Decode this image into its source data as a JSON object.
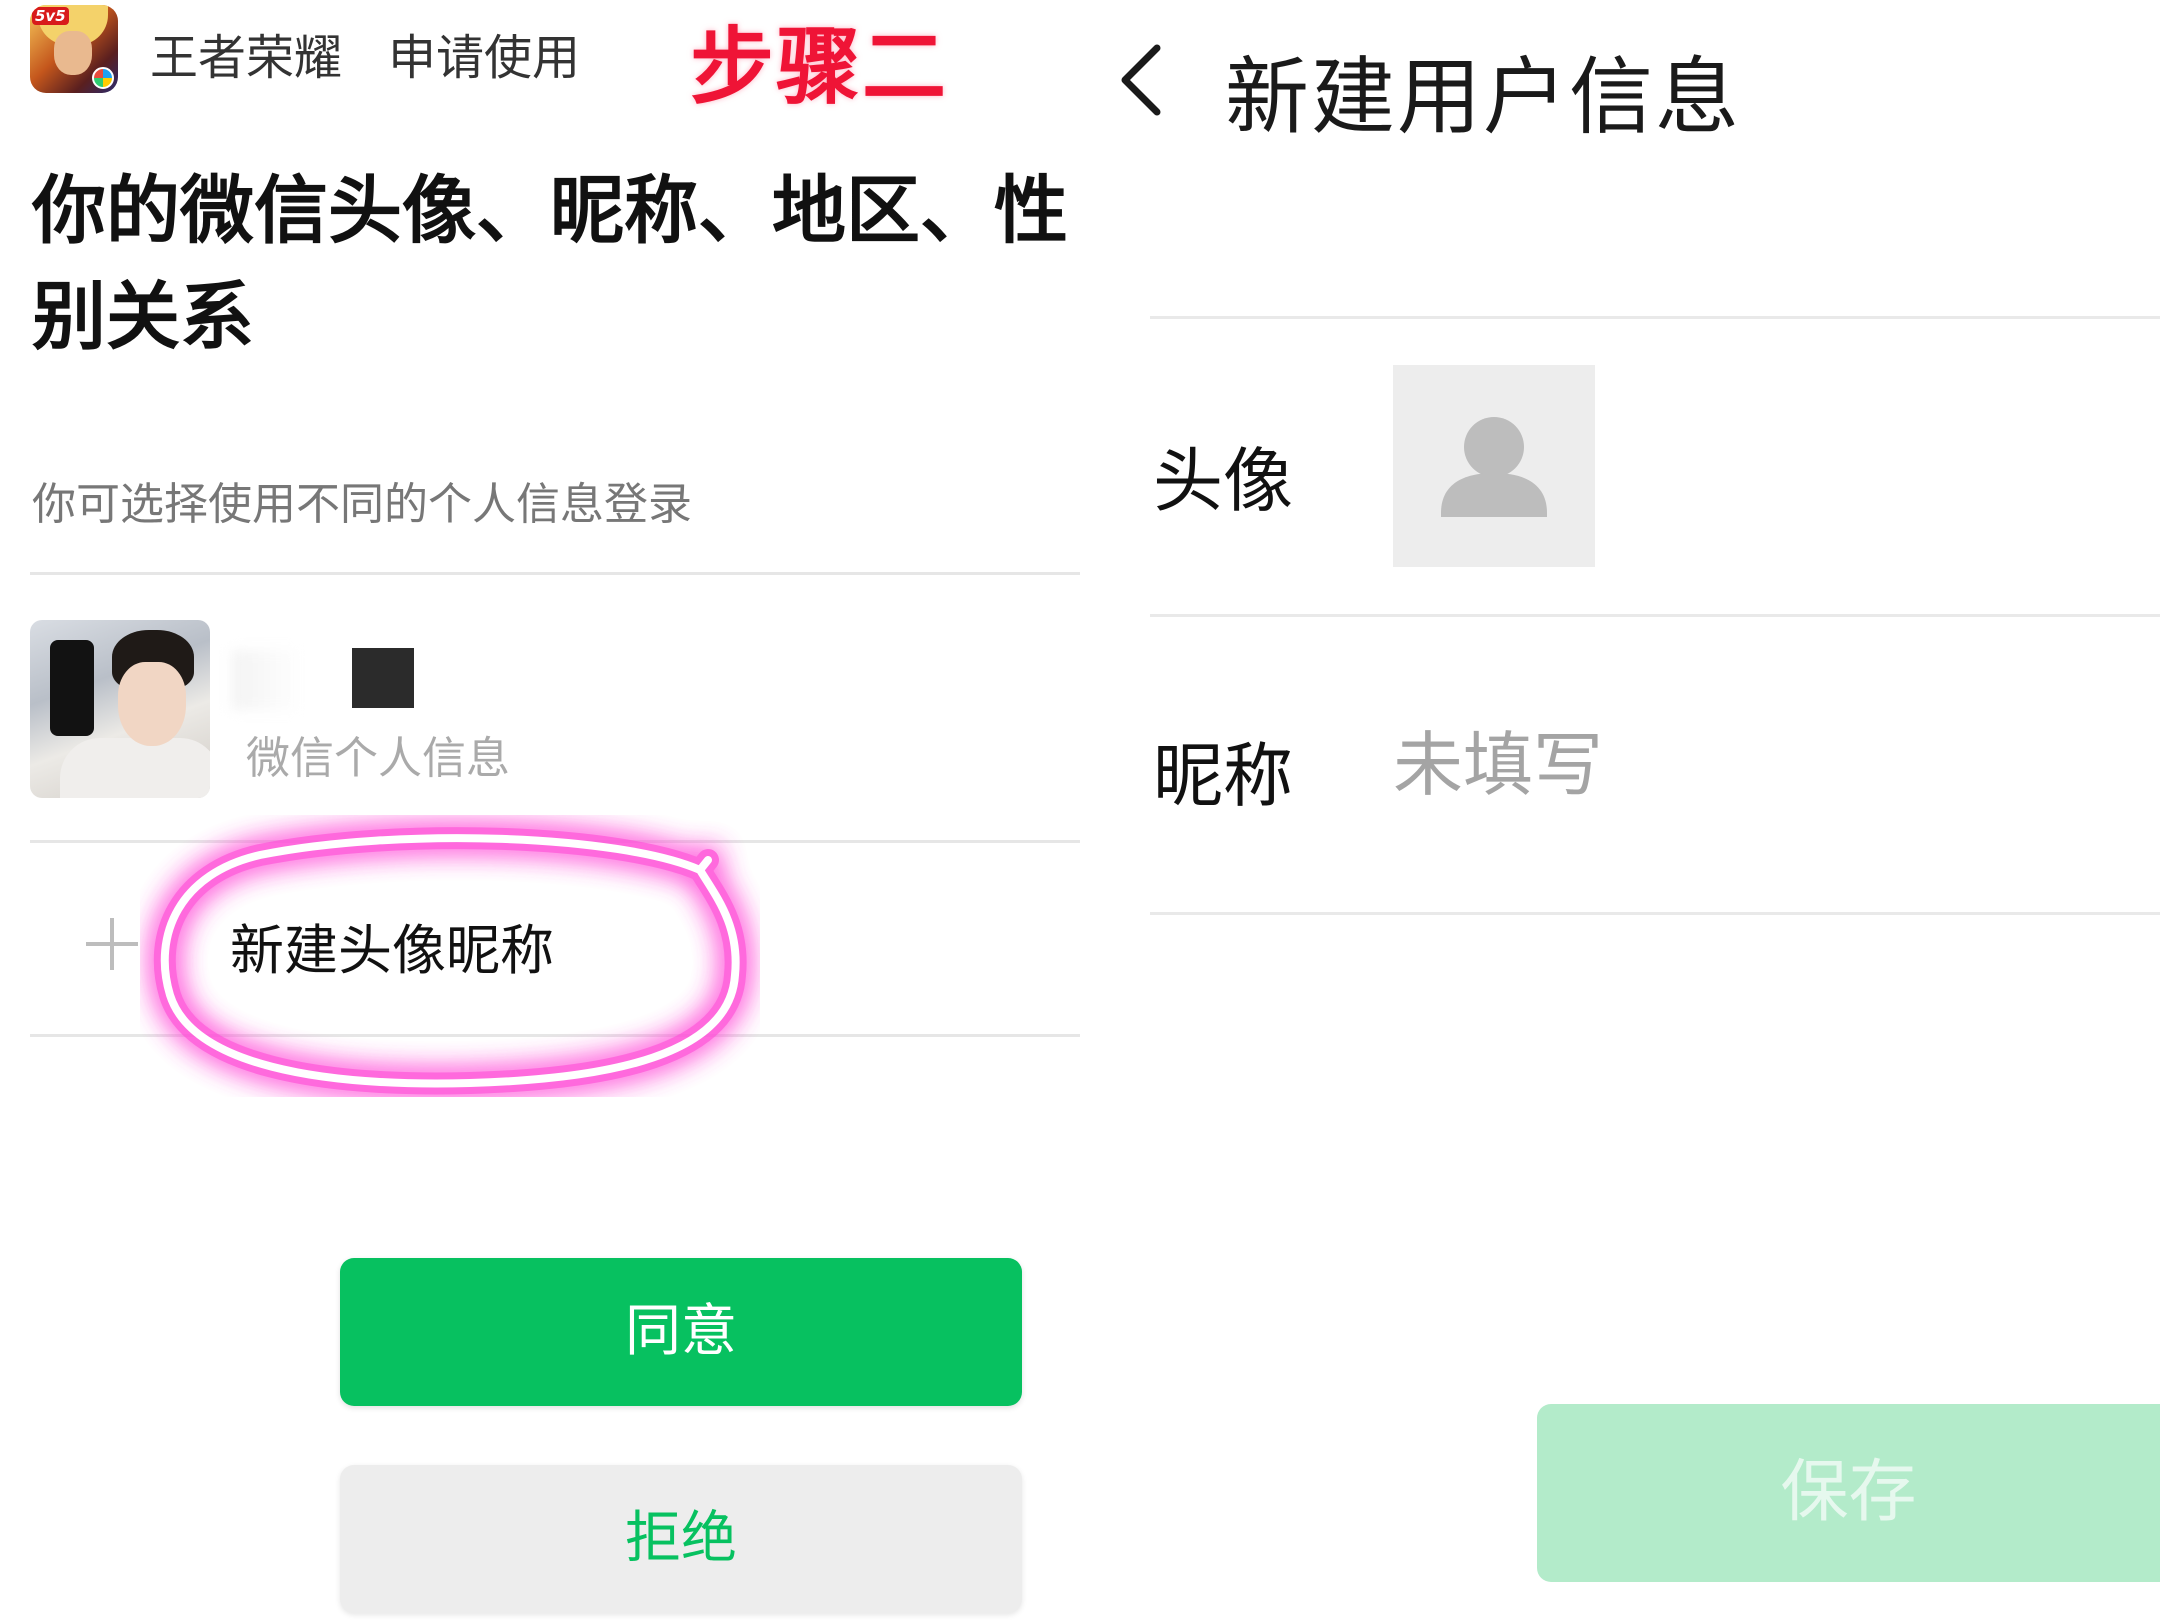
{
  "left_panel": {
    "header": {
      "app_name": "王者荣耀",
      "request_text": "申请使用",
      "app_icon_tag": "5v5",
      "step_label": "步骤二"
    },
    "title": "你的微信头像、昵称、地区、性别关系",
    "hint": "你可选择使用不同的个人信息登录",
    "profile": {
      "subtitle": "微信个人信息"
    },
    "new_profile": {
      "label": "新建头像昵称",
      "icon": "plus-icon"
    },
    "buttons": {
      "agree": "同意",
      "reject": "拒绝"
    }
  },
  "right_panel": {
    "header": {
      "back_icon": "chevron-left-icon",
      "title": "新建用户信息"
    },
    "form": {
      "avatar_label": "头像",
      "avatar_icon": "user-placeholder-icon",
      "nickname_label": "昵称",
      "nickname_value": "",
      "nickname_placeholder": "未填写"
    },
    "save": "保存"
  },
  "colors": {
    "wechat_green": "#07c160",
    "save_disabled_bg": "#b3ebca",
    "step_label_red": "#ef1436",
    "highlight_pink": "#ff4fd8"
  }
}
